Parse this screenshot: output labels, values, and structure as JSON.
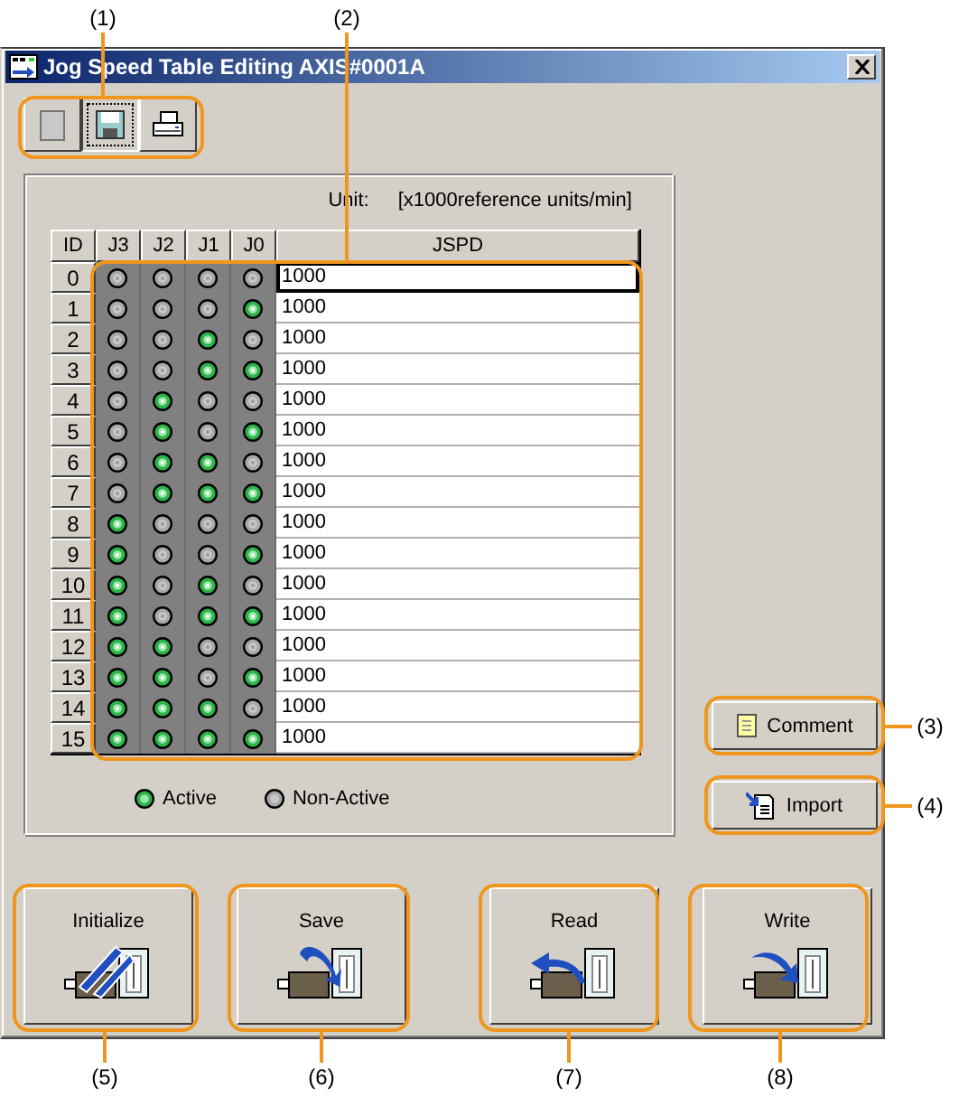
{
  "window": {
    "title": "Jog Speed Table Editing AXIS#0001A"
  },
  "toolbar": [
    {
      "kind": "blank",
      "focused": false
    },
    {
      "kind": "save",
      "focused": true
    },
    {
      "kind": "print",
      "focused": false
    }
  ],
  "unit_label": "Unit:",
  "unit_value": "[x1000reference units/min]",
  "table": {
    "columns": [
      "ID",
      "J3",
      "J2",
      "J1",
      "J0",
      "JSPD"
    ],
    "rows": [
      {
        "id": "0",
        "leds": [
          false,
          false,
          false,
          false
        ],
        "jspd": "1000",
        "focused": true
      },
      {
        "id": "1",
        "leds": [
          false,
          false,
          false,
          true
        ],
        "jspd": "1000",
        "focused": false
      },
      {
        "id": "2",
        "leds": [
          false,
          false,
          true,
          false
        ],
        "jspd": "1000",
        "focused": false
      },
      {
        "id": "3",
        "leds": [
          false,
          false,
          true,
          true
        ],
        "jspd": "1000",
        "focused": false
      },
      {
        "id": "4",
        "leds": [
          false,
          true,
          false,
          false
        ],
        "jspd": "1000",
        "focused": false
      },
      {
        "id": "5",
        "leds": [
          false,
          true,
          false,
          true
        ],
        "jspd": "1000",
        "focused": false
      },
      {
        "id": "6",
        "leds": [
          false,
          true,
          true,
          false
        ],
        "jspd": "1000",
        "focused": false
      },
      {
        "id": "7",
        "leds": [
          false,
          true,
          true,
          true
        ],
        "jspd": "1000",
        "focused": false
      },
      {
        "id": "8",
        "leds": [
          true,
          false,
          false,
          false
        ],
        "jspd": "1000",
        "focused": false
      },
      {
        "id": "9",
        "leds": [
          true,
          false,
          false,
          true
        ],
        "jspd": "1000",
        "focused": false
      },
      {
        "id": "10",
        "leds": [
          true,
          false,
          true,
          false
        ],
        "jspd": "1000",
        "focused": false
      },
      {
        "id": "11",
        "leds": [
          true,
          false,
          true,
          true
        ],
        "jspd": "1000",
        "focused": false
      },
      {
        "id": "12",
        "leds": [
          true,
          true,
          false,
          false
        ],
        "jspd": "1000",
        "focused": false
      },
      {
        "id": "13",
        "leds": [
          true,
          true,
          false,
          true
        ],
        "jspd": "1000",
        "focused": false
      },
      {
        "id": "14",
        "leds": [
          true,
          true,
          true,
          false
        ],
        "jspd": "1000",
        "focused": false
      },
      {
        "id": "15",
        "leds": [
          true,
          true,
          true,
          true
        ],
        "jspd": "1000",
        "focused": false
      }
    ]
  },
  "legend": [
    {
      "kind": "active",
      "label": "Active"
    },
    {
      "kind": "inactive",
      "label": "Non-Active"
    }
  ],
  "side_buttons": [
    {
      "kind": "comment",
      "label": "Comment"
    },
    {
      "kind": "import",
      "label": "Import"
    }
  ],
  "action_buttons": [
    {
      "kind": "initialize",
      "label": "Initialize"
    },
    {
      "kind": "save",
      "label": "Save"
    },
    {
      "kind": "read",
      "label": "Read"
    },
    {
      "kind": "write",
      "label": "Write"
    }
  ],
  "callouts": [
    "(1)",
    "(2)",
    "(3)",
    "(4)",
    "(5)",
    "(6)",
    "(7)",
    "(8)"
  ]
}
